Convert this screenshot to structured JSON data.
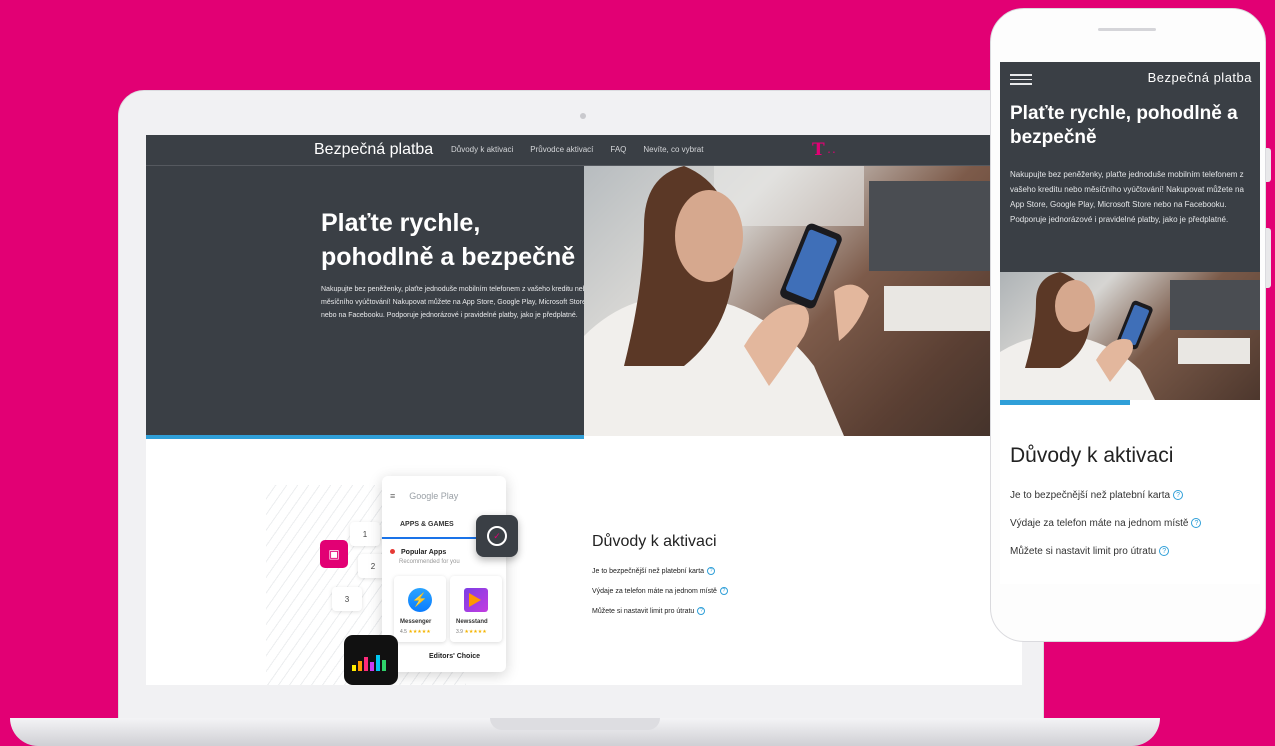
{
  "site": {
    "brand": "Bezpečná platba",
    "nav": [
      "Důvody k aktivaci",
      "Průvodce aktivací",
      "FAQ",
      "Nevíte, co vybrat"
    ],
    "logo": "T",
    "hero": {
      "title": "Plaťte rychle, pohodlně a bezpečně",
      "text": "Nakupujte bez peněženky, plaťte jednoduše mobilním telefonem z vašeho kreditu nebo měsíčního vyúčtování! Nakupovat můžete na App Store, Google Play, Microsoft Store nebo na Facebooku. Podporuje jednorázové i pravidelné platby, jako je předplatné."
    },
    "reasons": {
      "title": "Důvody k aktivaci",
      "items": [
        "Je to bezpečnější než platební karta",
        "Výdaje za telefon máte na jednom místě",
        "Můžete si nastavit limit pro útratu"
      ],
      "help_glyph": "?"
    }
  },
  "google_play": {
    "header": "Google Play",
    "menu_glyph": "≡",
    "tab": "APPS & GAMES",
    "section": "Popular Apps",
    "subtitle": "Recommended for you",
    "apps": [
      {
        "name": "Messenger",
        "rating": "4.5"
      },
      {
        "name": "Newsstand",
        "rating": "3.9"
      }
    ],
    "stars": "★★★★★",
    "editors": "Editors' Choice"
  },
  "steps": [
    "1",
    "2",
    "3"
  ],
  "colors": {
    "magenta": "#e20074",
    "dark": "#3a3f45",
    "accent_blue": "#2f9fd8"
  },
  "icons": [
    "hamburger-icon",
    "help-icon",
    "messenger-icon",
    "newsstand-icon",
    "timer-icon",
    "deezer-icon"
  ]
}
